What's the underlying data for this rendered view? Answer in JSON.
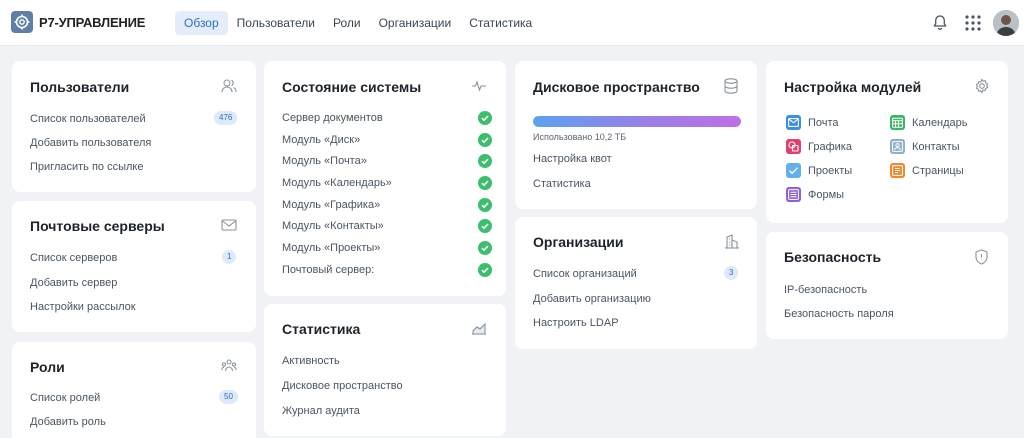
{
  "header": {
    "brand": "Р7-УПРАВЛЕНИЕ",
    "nav": [
      "Обзор",
      "Пользователи",
      "Роли",
      "Организации",
      "Статистика"
    ]
  },
  "users": {
    "title": "Пользователи",
    "list": "Список пользователей",
    "list_count": "476",
    "add": "Добавить пользователя",
    "invite": "Пригласить по ссылке"
  },
  "mail": {
    "title": "Почтовые серверы",
    "list": "Список серверов",
    "list_count": "1",
    "add": "Добавить сервер",
    "settings": "Настройки рассылок"
  },
  "roles": {
    "title": "Роли",
    "list": "Список ролей",
    "list_count": "50",
    "add": "Добавить роль"
  },
  "system": {
    "title": "Состояние системы",
    "items": [
      "Сервер документов",
      "Модуль «Диск»",
      "Модуль «Почта»",
      "Модуль «Календарь»",
      "Модуль «Графика»",
      "Модуль «Контакты»",
      "Модуль «Проекты»",
      "Почтовый сервер:"
    ]
  },
  "stats": {
    "title": "Статистика",
    "activity": "Активность",
    "disk": "Дисковое пространство",
    "audit": "Журнал аудита"
  },
  "disk": {
    "title": "Дисковое пространство",
    "used": "Использовано 10,2 ТБ",
    "used_fraction": 1.0,
    "quota": "Настройка квот",
    "stats": "Статистика"
  },
  "orgs": {
    "title": "Организации",
    "list": "Список организаций",
    "list_count": "3",
    "add": "Добавить организацию",
    "ldap": "Настроить LDAP"
  },
  "modules": {
    "title": "Настройка модулей",
    "mail": "Почта",
    "calendar": "Календарь",
    "graphics": "Графика",
    "contacts": "Контакты",
    "projects": "Проекты",
    "pages": "Страницы",
    "forms": "Формы"
  },
  "security": {
    "title": "Безопасность",
    "ip": "IP-безопасность",
    "password": "Безопасность пароля"
  }
}
